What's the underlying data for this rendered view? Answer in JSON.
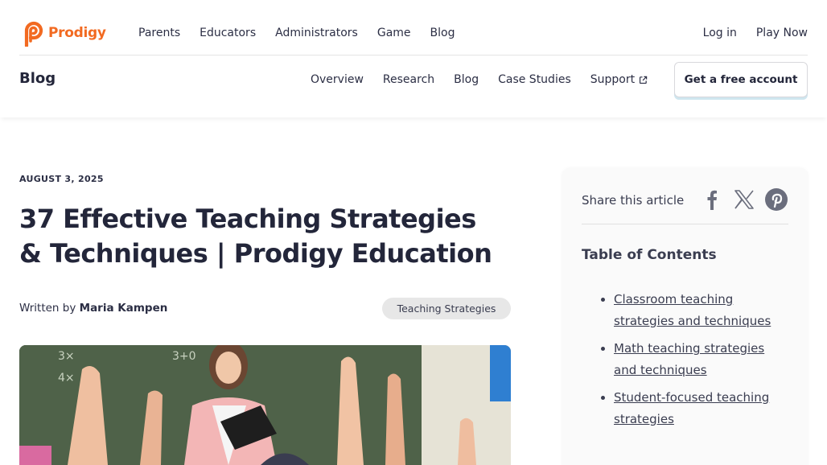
{
  "brand": {
    "name": "Prodigy",
    "color": "#f26a21"
  },
  "main_nav": [
    "Parents",
    "Educators",
    "Administrators",
    "Game",
    "Blog"
  ],
  "account_nav": {
    "login": "Log in",
    "play": "Play Now"
  },
  "sub_nav": {
    "section_title": "Blog",
    "items": [
      "Overview",
      "Research",
      "Blog",
      "Case Studies",
      "Support"
    ],
    "external_icon": "external-link-icon",
    "cta": "Get a free account"
  },
  "article": {
    "date": "AUGUST 3, 2025",
    "title": "37 Effective Teaching Strategies & Techniques | Prodigy Education",
    "author_prefix": "Written by ",
    "author_name": "Maria Kampen",
    "tag": "Teaching Strategies"
  },
  "sidebar": {
    "share_label": "Share this article",
    "share_icons": [
      "facebook-icon",
      "x-icon",
      "pinterest-icon"
    ],
    "toc_title": "Table of Contents",
    "toc_items": [
      "Classroom teaching strategies and techniques",
      "Math teaching strategies and techniques",
      "Student-focused teaching strategies"
    ]
  },
  "colors": {
    "accent": "#f26a21",
    "text": "#23263a",
    "tag_bg": "#e7e7e7",
    "icon_gray": "#6b6e7d"
  }
}
